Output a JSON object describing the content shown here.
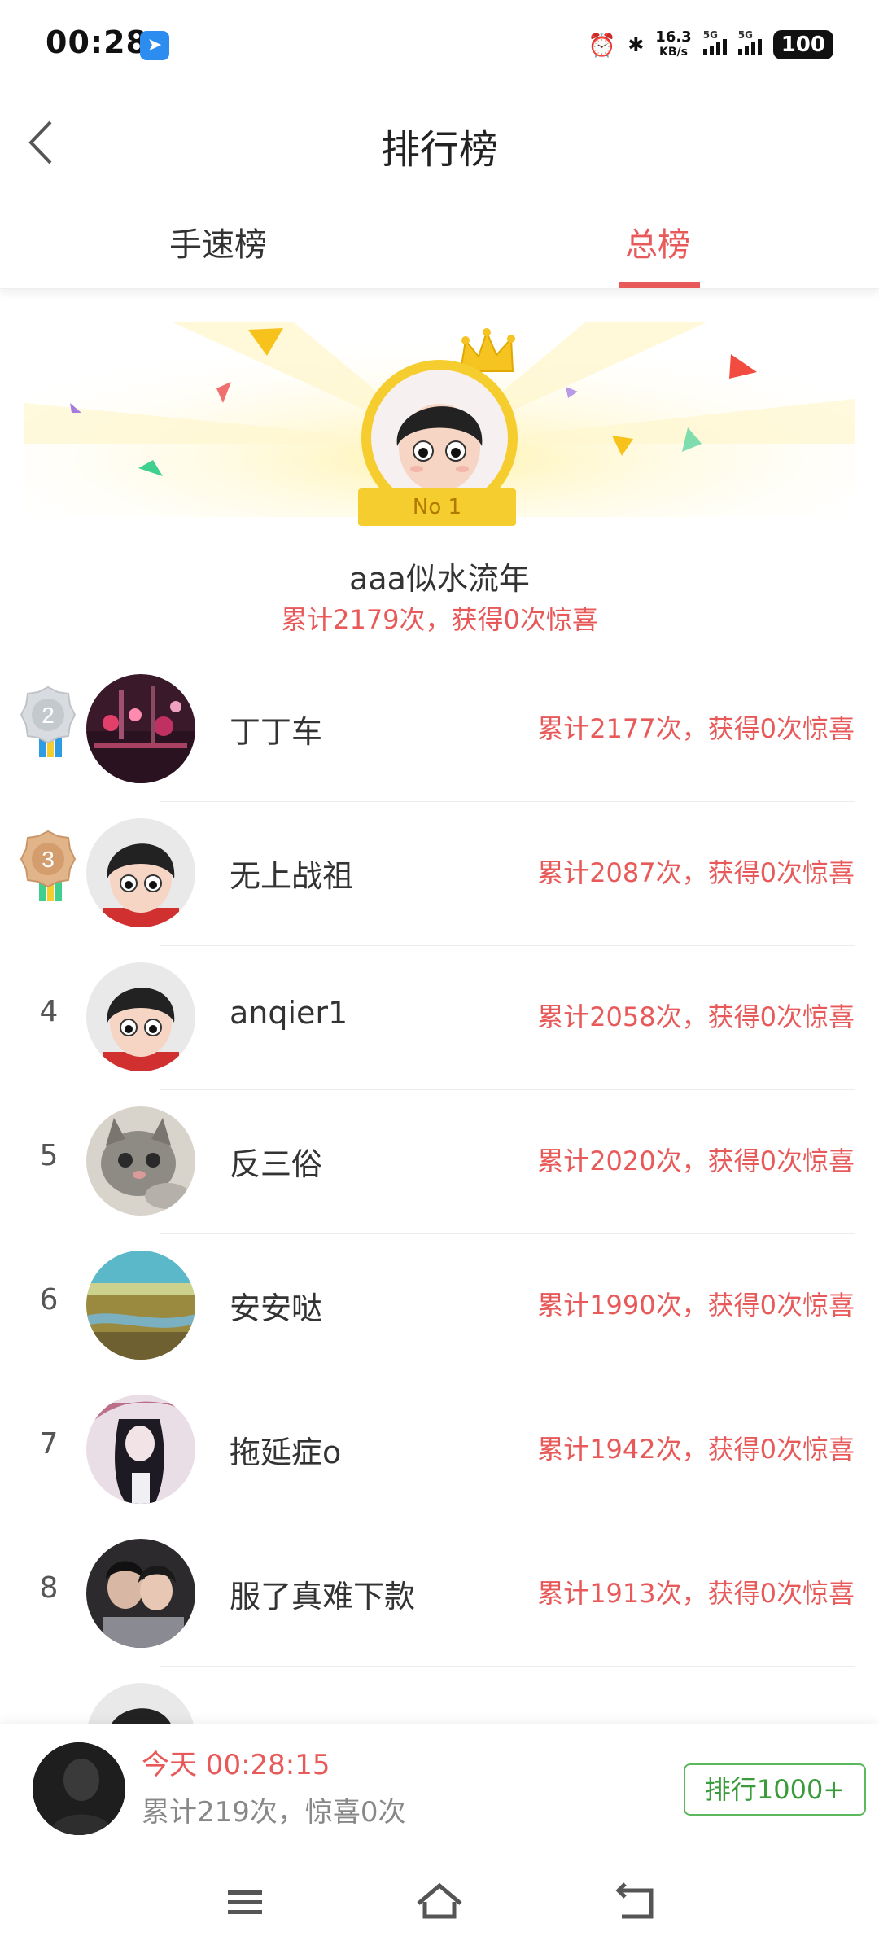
{
  "status_bar": {
    "time": "00:28",
    "speed_value": "16.3",
    "speed_unit": "KB/s",
    "network_1": "5G",
    "network_2": "5G",
    "battery": "100"
  },
  "header": {
    "title": "排行榜"
  },
  "tabs": [
    {
      "label": "手速榜",
      "active": false
    },
    {
      "label": "总榜",
      "active": true
    }
  ],
  "top1": {
    "badge": "No 1",
    "name": "aaa似水流年",
    "stats": "累计2179次，获得0次惊喜"
  },
  "ranking": [
    {
      "rank": "2",
      "name": "丁丁车",
      "stats": "累计2177次，获得0次惊喜"
    },
    {
      "rank": "3",
      "name": "无上战祖",
      "stats": "累计2087次，获得0次惊喜"
    },
    {
      "rank": "4",
      "name": "anqier1",
      "stats": "累计2058次，获得0次惊喜"
    },
    {
      "rank": "5",
      "name": "反三俗",
      "stats": "累计2020次，获得0次惊喜"
    },
    {
      "rank": "6",
      "name": "安安哒",
      "stats": "累计1990次，获得0次惊喜"
    },
    {
      "rank": "7",
      "name": "拖延症o",
      "stats": "累计1942次，获得0次惊喜"
    },
    {
      "rank": "8",
      "name": "服了真难下款",
      "stats": "累计1913次，获得0次惊喜"
    }
  ],
  "my_rank": {
    "time": "今天 00:28:15",
    "stats": "累计219次，惊喜0次",
    "rank_button": "排行1000+"
  },
  "colors": {
    "accent": "#e85a5a",
    "rank_button": "#5cb85c",
    "gold": "#f6cd2e"
  }
}
